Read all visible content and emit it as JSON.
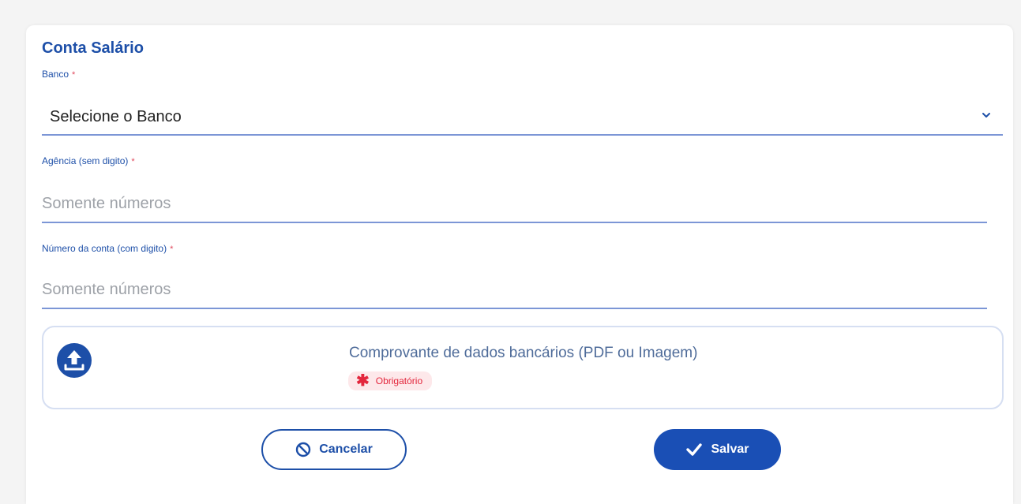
{
  "form": {
    "title": "Conta Salário",
    "required_mark": "*",
    "bank": {
      "label": "Banco",
      "value": "Selecione o Banco"
    },
    "agency": {
      "label": "Agência (sem digito)",
      "placeholder": "Somente números",
      "value": ""
    },
    "account": {
      "label": "Número da conta (com digito)",
      "placeholder": "Somente números",
      "value": ""
    },
    "upload": {
      "title": "Comprovante de dados bancários (PDF ou Imagem)",
      "badge_icon": "✱",
      "badge": "Obrigatório",
      "icon": "upload-icon"
    },
    "buttons": {
      "cancel": "Cancelar",
      "save": "Salvar"
    }
  },
  "colors": {
    "primary": "#1d4fa8",
    "required": "#e3263c",
    "badge_bg": "#fde8ea",
    "underline": "#7c96d6"
  }
}
